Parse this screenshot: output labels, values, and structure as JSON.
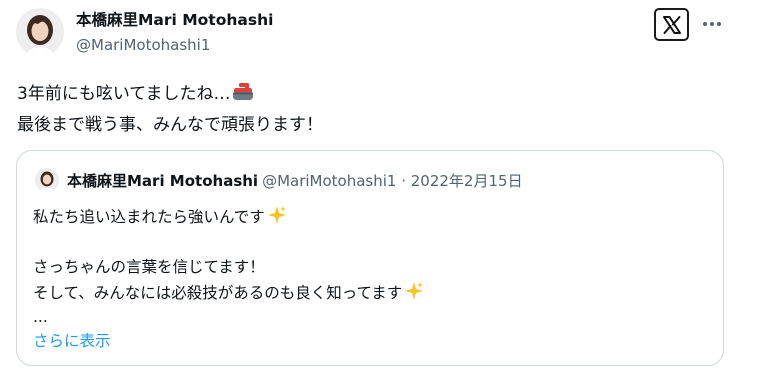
{
  "author": {
    "display_name": "本橋麻里Mari Motohashi",
    "handle": "@MariMotohashi1"
  },
  "tweet": {
    "line1": "3年前にも呟いてましたね…",
    "line1_icon": "curling-stone-icon",
    "line2": "最後まで戦う事、みんなで頑張ります！"
  },
  "quoted": {
    "display_name": "本橋麻里Mari Motohashi",
    "meta": "@MariMotohashi1 · 2022年2月15日",
    "line1": "私たち追い込まれたら強いんです",
    "line2": "さっちゃんの言葉を信じてます！",
    "line3": "そして、みんなには必殺技があるのも良く知ってます",
    "line4": "...",
    "show_more": "さらに表示",
    "sparkle_icon": "sparkles-icon"
  },
  "header_icons": {
    "logo": "x-logo-icon",
    "more": "more-dots-icon"
  },
  "colors": {
    "text": "#0f1419",
    "secondary": "#536471",
    "link": "#1d9bf0",
    "border": "#cfd9de"
  }
}
